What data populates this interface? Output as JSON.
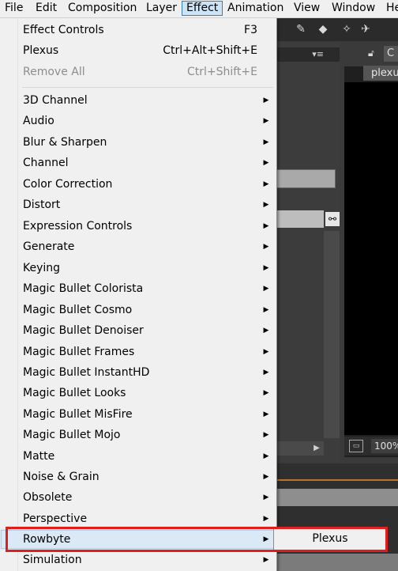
{
  "menubar": {
    "items": [
      {
        "label": "File"
      },
      {
        "label": "Edit"
      },
      {
        "label": "Composition"
      },
      {
        "label": "Layer"
      },
      {
        "label": "Effect",
        "active": true
      },
      {
        "label": "Animation"
      },
      {
        "label": "View"
      },
      {
        "label": "Window"
      },
      {
        "label": "He"
      }
    ]
  },
  "effect_menu": {
    "top_items": [
      {
        "label": "Effect Controls",
        "shortcut": "F3"
      },
      {
        "label": "Plexus",
        "shortcut": "Ctrl+Alt+Shift+E"
      },
      {
        "label": "Remove All",
        "shortcut": "Ctrl+Shift+E",
        "disabled": true
      }
    ],
    "categories": [
      "3D Channel",
      "Audio",
      "Blur & Sharpen",
      "Channel",
      "Color Correction",
      "Distort",
      "Expression Controls",
      "Generate",
      "Keying",
      "Magic Bullet Colorista",
      "Magic Bullet Cosmo",
      "Magic Bullet Denoiser",
      "Magic Bullet Frames",
      "Magic Bullet InstantHD",
      "Magic Bullet Looks",
      "Magic Bullet MisFire",
      "Magic Bullet Mojo",
      "Matte",
      "Noise & Grain",
      "Obsolete",
      "Perspective",
      "Rowbyte",
      "Simulation"
    ],
    "hovered": "Rowbyte"
  },
  "submenu": {
    "items": [
      "Plexus"
    ]
  },
  "background": {
    "comp_tab": "plexu",
    "tab_c": "C",
    "zoom": "100%"
  },
  "colors": {
    "highlight_border": "#e01e1e",
    "active_menu_bg": "#cde4f7",
    "menu_bg": "#f0f0f0"
  }
}
